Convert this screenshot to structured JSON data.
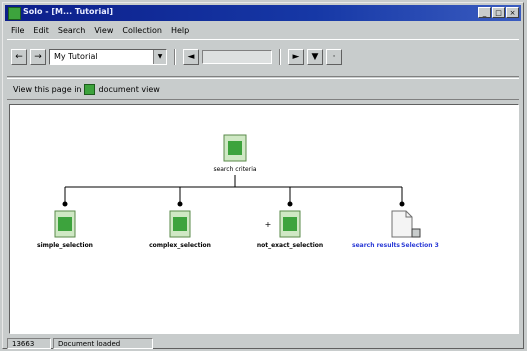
{
  "window": {
    "title": "Solo - [M... Tutorial]",
    "buttons": [
      "_",
      "□",
      "×"
    ]
  },
  "menu": [
    "File",
    "Edit",
    "Search",
    "View",
    "Collection",
    "Help"
  ],
  "toolbar": {
    "back_icon": "back-arrow-icon",
    "forward_icon": "forward-arrow-icon",
    "combo_value": "My Tutorial",
    "field_value": "",
    "nav_buttons": [
      "◄",
      "►",
      "▼"
    ]
  },
  "address": {
    "label": "View this page in",
    "value": "document view"
  },
  "tree": {
    "root": {
      "label": "search criteria"
    },
    "children": [
      {
        "label": "simple_selection",
        "type": "doc",
        "color": "#000000"
      },
      {
        "label": "complex_selection",
        "type": "doc",
        "color": "#000000"
      },
      {
        "label": "not_exact_selection",
        "type": "doc",
        "color": "#000000",
        "prefix": "+"
      },
      {
        "label": "search results",
        "type": "blank",
        "color": "#2b3bd6",
        "extra": "Selection 3"
      }
    ]
  },
  "status": {
    "left": "13663",
    "right": "Document loaded"
  },
  "colors": {
    "titlebar": "#0c1e8a",
    "link": "#2b3bd6",
    "doc_icon": "#3da33d"
  }
}
